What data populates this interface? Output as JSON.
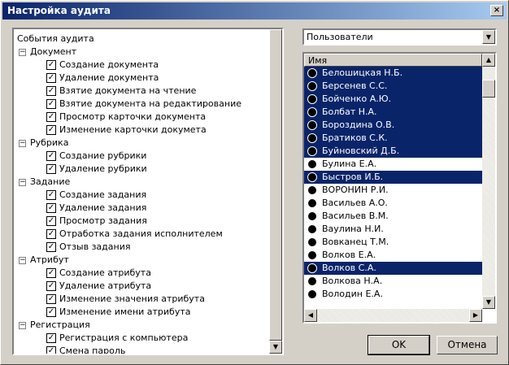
{
  "window": {
    "title": "Настройка аудита",
    "close_label": "×"
  },
  "tree": {
    "root": "События аудита",
    "groups": [
      {
        "label": "Документ",
        "items": [
          "Создание документа",
          "Удаление документа",
          "Взятие документа на чтение",
          "Взятие документа на редактирование",
          "Просмотр карточки документа",
          "Изменение карточки докумета"
        ]
      },
      {
        "label": "Рубрика",
        "items": [
          "Создание рубрики",
          "Удаление рубрики"
        ]
      },
      {
        "label": "Задание",
        "items": [
          "Создание задания",
          "Удаление задания",
          "Просмотр задания",
          "Отработка задания исполнителем",
          "Отзыв задания"
        ]
      },
      {
        "label": "Атрибут",
        "items": [
          "Создание атрибута",
          "Удаление атрибута",
          "Изменение значения атрибута",
          "Изменение имени атрибута"
        ]
      },
      {
        "label": "Регистрация",
        "items": [
          "Регистрация с компьютера",
          "Смена пароль"
        ]
      }
    ]
  },
  "combo": {
    "value": "Пользователи"
  },
  "list": {
    "column_header": "Имя",
    "users": [
      {
        "name": "Белошицкая Н.Б.",
        "selected": true
      },
      {
        "name": "Берсенев С.С.",
        "selected": true
      },
      {
        "name": "Бойченко А.Ю.",
        "selected": true
      },
      {
        "name": "Болбат Н.А.",
        "selected": true
      },
      {
        "name": "Бороздина О.В.",
        "selected": true
      },
      {
        "name": "Братиков С.К.",
        "selected": true
      },
      {
        "name": "Буйновский Д.Б.",
        "selected": true
      },
      {
        "name": "Булина Е.А.",
        "selected": false
      },
      {
        "name": "Быстров И.Б.",
        "selected": true
      },
      {
        "name": "ВОРОНИН Р.И.",
        "selected": false
      },
      {
        "name": "Васильев А.О.",
        "selected": false
      },
      {
        "name": "Васильев В.М.",
        "selected": false
      },
      {
        "name": "Ваулина Н.И.",
        "selected": false
      },
      {
        "name": "Вовканец Т.М.",
        "selected": false
      },
      {
        "name": "Волков Е.А.",
        "selected": false
      },
      {
        "name": "Волков С.А.",
        "selected": true
      },
      {
        "name": "Волкова Н.А.",
        "selected": false
      },
      {
        "name": "Володин Е.А.",
        "selected": false
      }
    ]
  },
  "buttons": {
    "ok": "OK",
    "cancel": "Отмена"
  },
  "icons": {
    "checked": "✓",
    "expander": "−"
  }
}
